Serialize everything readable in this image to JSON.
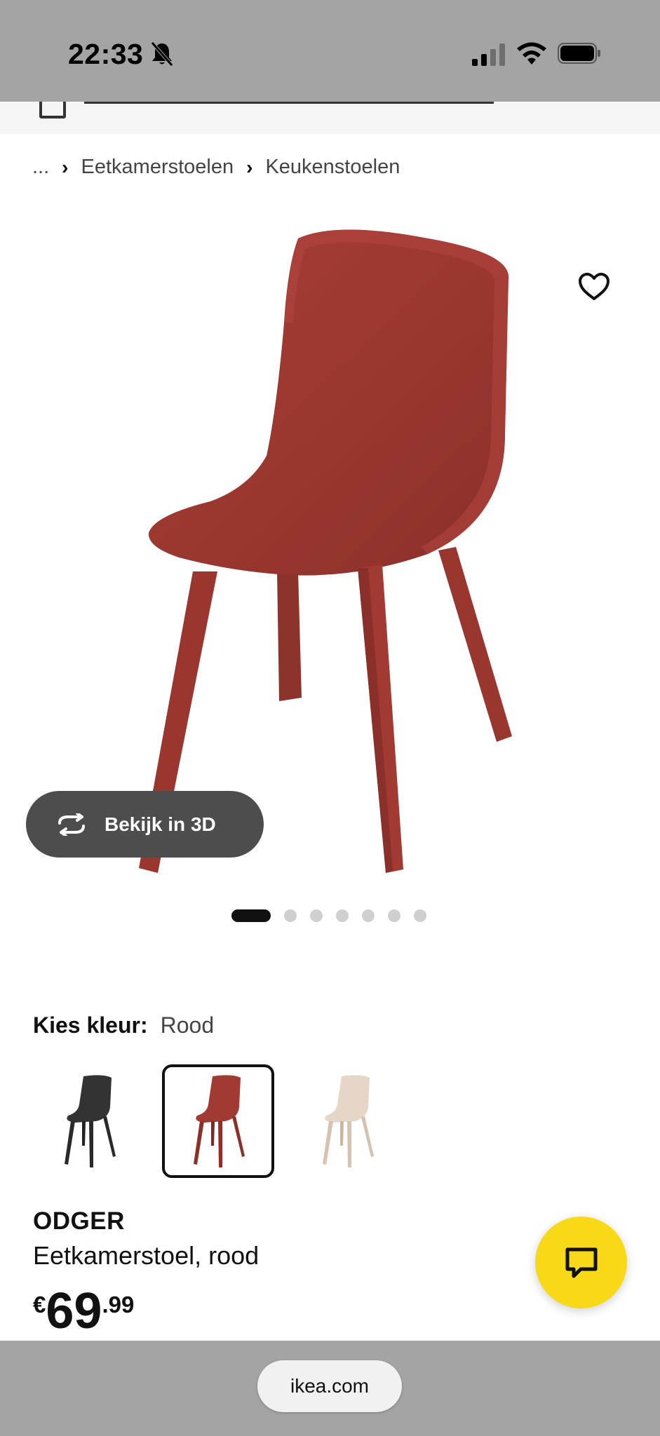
{
  "status_bar": {
    "time": "22:33"
  },
  "breadcrumb": {
    "ellipsis": "...",
    "items": [
      "Eetkamerstoelen",
      "Keukenstoelen"
    ]
  },
  "gallery": {
    "view_3d_label": "Bekijk in 3D",
    "image_count": 7,
    "active_index": 0
  },
  "color": {
    "label": "Kies kleur:",
    "selected": "Rood",
    "options": [
      {
        "name": "zwart",
        "color": "#2f2f2f"
      },
      {
        "name": "rood",
        "color": "#9c3a33"
      },
      {
        "name": "wit",
        "color": "#e3d3c4"
      }
    ],
    "selected_index": 1
  },
  "product": {
    "name": "ODGER",
    "description": "Eetkamerstoel, rood",
    "price_currency": "€",
    "price_int": "69",
    "price_dec": ".99"
  },
  "colors": {
    "chair_red": "#a03a33",
    "chat_yellow": "#f7d917",
    "bar_gray": "#a4a4a4"
  },
  "browser": {
    "url": "ikea.com"
  }
}
